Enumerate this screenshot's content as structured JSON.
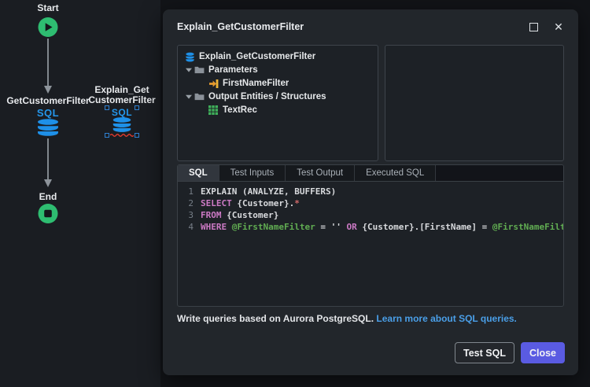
{
  "canvas": {
    "nodes": {
      "start": {
        "label": "Start"
      },
      "get_customer_filter": {
        "label": "GetCustomerFilter",
        "badge": "SQL"
      },
      "explain_get_customer_filter": {
        "label_line1": "Explain_Get",
        "label_line2": "CustomerFilter",
        "badge": "SQL",
        "state": "selected-with-error"
      },
      "end": {
        "label": "End"
      }
    }
  },
  "dialog": {
    "title": "Explain_GetCustomerFilter",
    "tree": {
      "root": "Explain_GetCustomerFilter",
      "groups": [
        {
          "label": "Parameters",
          "children": [
            {
              "label": "FirstNameFilter",
              "icon": "input-parameter-icon"
            }
          ]
        },
        {
          "label": "Output Entities / Structures",
          "children": [
            {
              "label": "TextRec",
              "icon": "structure-icon"
            }
          ]
        }
      ]
    },
    "tabs": [
      {
        "label": "SQL",
        "active": true
      },
      {
        "label": "Test Inputs",
        "active": false
      },
      {
        "label": "Test Output",
        "active": false
      },
      {
        "label": "Executed SQL",
        "active": false
      }
    ],
    "sql_editor": {
      "lines": [
        {
          "number": 1,
          "tokens": [
            {
              "text": "EXPLAIN (ANALYZE, BUFFERS)",
              "type": "plain"
            }
          ]
        },
        {
          "number": 2,
          "tokens": [
            {
              "text": "SELECT",
              "type": "keyword"
            },
            {
              "text": " {Customer}.",
              "type": "plain"
            },
            {
              "text": "*",
              "type": "star"
            }
          ]
        },
        {
          "number": 3,
          "tokens": [
            {
              "text": "FROM",
              "type": "keyword"
            },
            {
              "text": " {Customer}",
              "type": "plain"
            }
          ]
        },
        {
          "number": 4,
          "tokens": [
            {
              "text": "WHERE",
              "type": "keyword"
            },
            {
              "text": " ",
              "type": "plain"
            },
            {
              "text": "@FirstNameFilter",
              "type": "param"
            },
            {
              "text": " = '' ",
              "type": "plain"
            },
            {
              "text": "OR",
              "type": "keyword"
            },
            {
              "text": " {Customer}.[FirstName] = ",
              "type": "plain"
            },
            {
              "text": "@FirstNameFilter",
              "type": "param"
            }
          ]
        }
      ]
    },
    "footer": {
      "text": "Write queries based on Aurora PostgreSQL.",
      "link": "Learn more about SQL queries."
    },
    "buttons": {
      "test_sql": "Test SQL",
      "close": "Close"
    }
  },
  "colors": {
    "sql_blue": "#2496ea",
    "node_green": "#2ebd71",
    "error_red": "#e23b2e",
    "selection_blue": "#2f80d0",
    "link_blue": "#4a9fe8",
    "close_button_purple": "#5a5be2",
    "keyword_magenta": "#cc7ac5",
    "parameter_green": "#61ad52"
  }
}
